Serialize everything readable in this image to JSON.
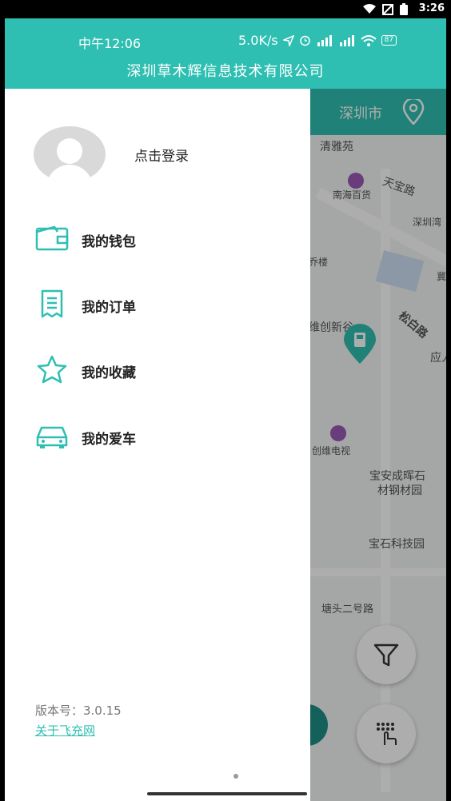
{
  "system_status": {
    "time": "3:26"
  },
  "inner_status": {
    "clock": "中午12:06",
    "speed": "5.0K/s",
    "battery": "87"
  },
  "header": {
    "company": "深圳草木辉信息技术有限公司"
  },
  "map": {
    "city": "深圳市",
    "labels": [
      "清雅苑",
      "南海百货",
      "天宝路",
      "深圳湾",
      "松白路",
      "维创新谷",
      "应人",
      "创维电视",
      "宝安成晖石",
      "材钢材园",
      "宝石科技园",
      "塘头二号路",
      "乔楼",
      "冀"
    ]
  },
  "drawer": {
    "login": "点击登录",
    "menu": [
      {
        "label": "我的钱包",
        "icon": "wallet-icon"
      },
      {
        "label": "我的订单",
        "icon": "receipt-icon"
      },
      {
        "label": "我的收藏",
        "icon": "star-icon"
      },
      {
        "label": "我的爱车",
        "icon": "car-icon"
      }
    ],
    "version": "版本号：3.0.15",
    "about": "关于飞充网"
  },
  "colors": {
    "accent": "#2ebfb2"
  }
}
